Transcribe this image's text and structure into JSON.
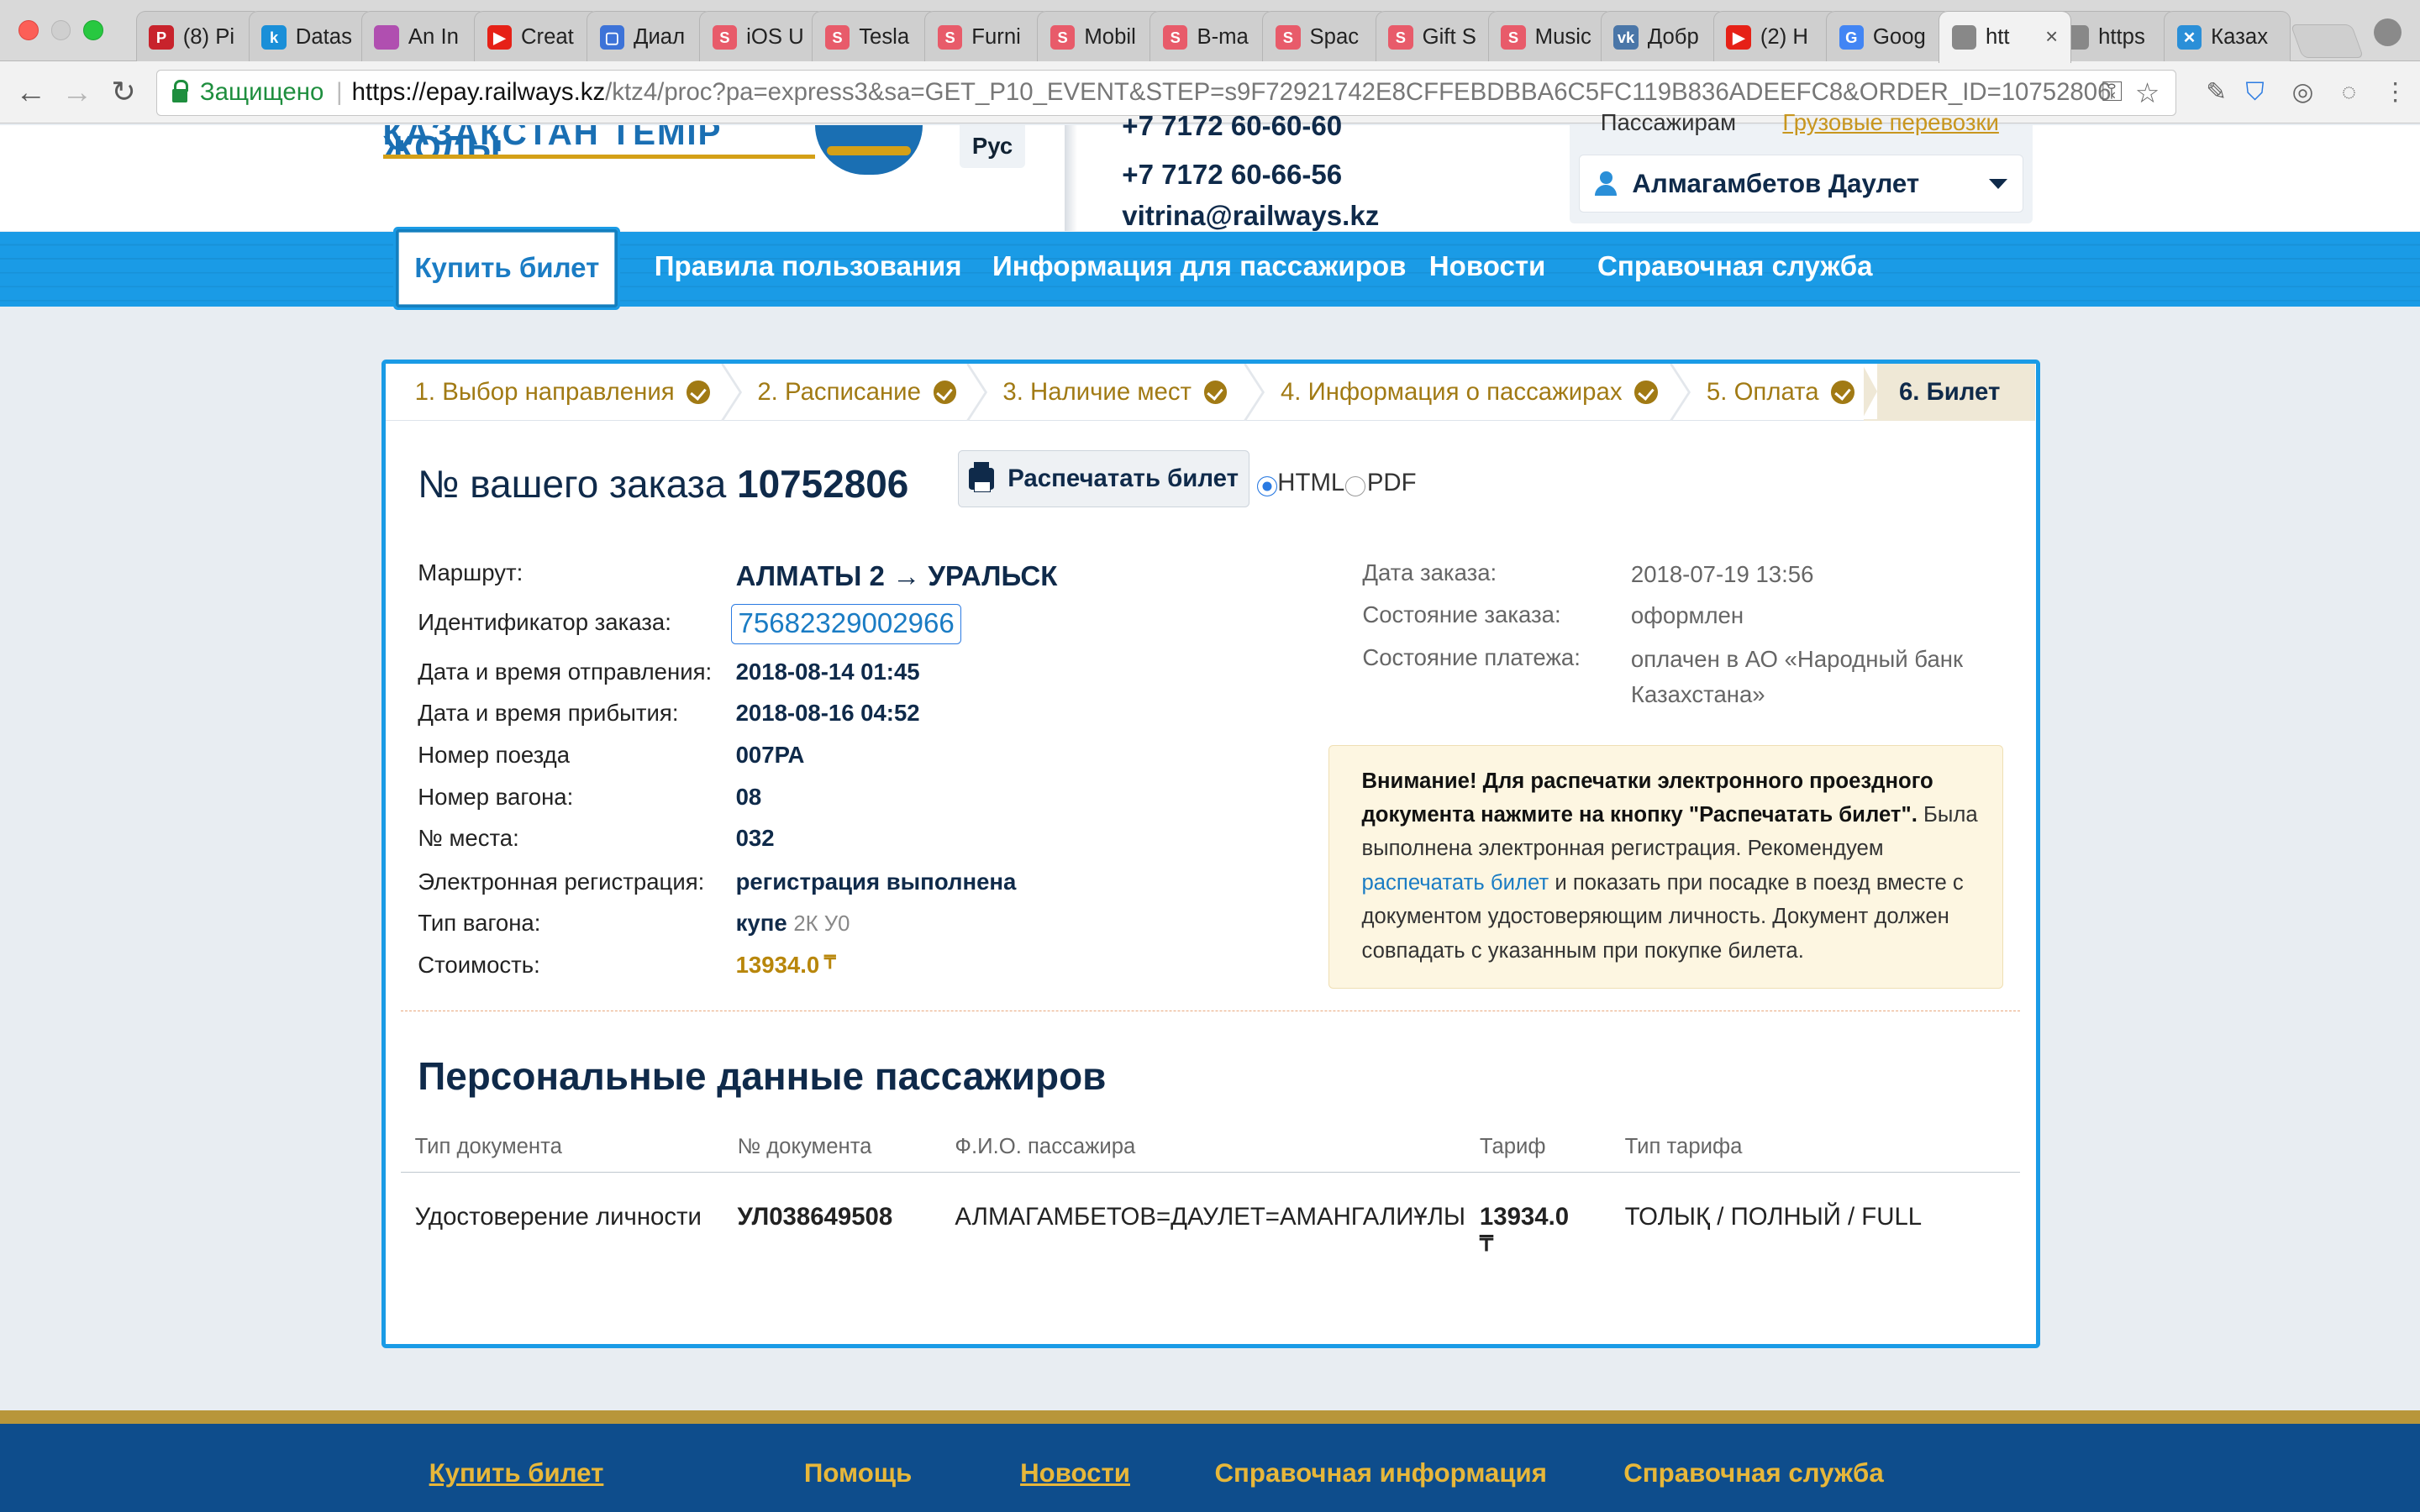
{
  "browser": {
    "tabs": [
      {
        "title": "(8) Pi",
        "icon": "pinterest-icon",
        "color": "#c8232c",
        "glyph": "P"
      },
      {
        "title": "Datas",
        "icon": "k-icon",
        "color": "#1a8fd8",
        "glyph": "k"
      },
      {
        "title": "An In",
        "icon": "gradient-circle-icon",
        "color": "#b04fb0",
        "glyph": ""
      },
      {
        "title": "Creat",
        "icon": "youtube-icon",
        "color": "#e62117",
        "glyph": "▶"
      },
      {
        "title": "Диал",
        "icon": "chat-icon",
        "color": "#3d73d8",
        "glyph": "▢"
      },
      {
        "title": "iOS U",
        "icon": "s-icon",
        "color": "#e85b6a",
        "glyph": "S"
      },
      {
        "title": "Tesla",
        "icon": "s-icon",
        "color": "#e85b6a",
        "glyph": "S"
      },
      {
        "title": "Furni",
        "icon": "s-icon",
        "color": "#e85b6a",
        "glyph": "S"
      },
      {
        "title": "Mobil",
        "icon": "s-icon",
        "color": "#e85b6a",
        "glyph": "S"
      },
      {
        "title": "B-ma",
        "icon": "s-icon",
        "color": "#e85b6a",
        "glyph": "S"
      },
      {
        "title": "Spac",
        "icon": "s-icon",
        "color": "#e85b6a",
        "glyph": "S"
      },
      {
        "title": "Gift S",
        "icon": "s-icon",
        "color": "#e85b6a",
        "glyph": "S"
      },
      {
        "title": "Music",
        "icon": "s-icon",
        "color": "#e85b6a",
        "glyph": "S"
      },
      {
        "title": "Добр",
        "icon": "vk-icon",
        "color": "#4a76a8",
        "glyph": "vk"
      },
      {
        "title": "(2) H",
        "icon": "youtube-icon",
        "color": "#e62117",
        "glyph": "▶"
      },
      {
        "title": "Goog",
        "icon": "google-translate-icon",
        "color": "#4285f4",
        "glyph": "G"
      },
      {
        "title": "htt",
        "icon": "page-icon",
        "color": "#888888",
        "glyph": "",
        "active": true
      },
      {
        "title": "https",
        "icon": "page-icon",
        "color": "#888888",
        "glyph": ""
      },
      {
        "title": "Казах",
        "icon": "globe-icon",
        "color": "#2a8fd8",
        "glyph": "✕"
      }
    ],
    "secure_label": "Защищено",
    "url_host": "https://epay.railways.kz",
    "url_path": "/ktz4/proc?pa=express3&sa=GET_P10_EVENT&STEP=s9F72921742E8CFFEBDBBA6C5FC119B836ADEEFC8&ORDER_ID=10752806"
  },
  "header": {
    "logo_text": "ҚАЗАҚСТАН ТЕМІР ЖОЛЫ",
    "lang": "Рус",
    "phone1": "+7 7172 60-60-60",
    "phone2": "+7 7172 60-66-56",
    "email": "vitrina@railways.kz",
    "tab_passengers": "Пассажирам",
    "tab_cargo": "Грузовые перевозки",
    "user_name": "Алмагамбетов Даулет"
  },
  "nav": {
    "buy": "Купить билет",
    "rules": "Правила пользования",
    "info": "Информация для пассажиров",
    "news": "Новости",
    "help": "Справочная служба"
  },
  "steps": [
    "1. Выбор направления",
    "2. Расписание",
    "3. Наличие мест",
    "4. Информация о пассажирах",
    "5. Оплата"
  ],
  "step_active": "6. Билет",
  "order": {
    "title_prefix": "№ вашего заказа",
    "number": "10752806",
    "print_label": "Распечатать билет",
    "format_html": "HTML",
    "format_pdf": "PDF"
  },
  "details": {
    "route_label": "Маршрут:",
    "route": "АЛМАТЫ 2 → УРАЛЬСК",
    "id_label": "Идентификатор заказа:",
    "id": "75682329002966",
    "dep_label": "Дата и время отправления:",
    "dep": "2018-08-14 01:45",
    "arr_label": "Дата и время прибытия:",
    "arr": "2018-08-16 04:52",
    "train_label": "Номер поезда",
    "train": "007РА",
    "car_label": "Номер вагона:",
    "car": "08",
    "seat_label": "№ места:",
    "seat": "032",
    "ereg_label": "Электронная регистрация:",
    "ereg": "регистрация выполнена",
    "cartype_label": "Тип вагона:",
    "cartype": "купе",
    "cartype_code": "2К У0",
    "cost_label": "Стоимость:",
    "cost": "13934.0",
    "currency": "₸"
  },
  "status": {
    "date_label": "Дата заказа:",
    "date": "2018-07-19 13:56",
    "state_label": "Состояние заказа:",
    "state": "оформлен",
    "pay_label": "Состояние платежа:",
    "pay": "оплачен в АО «Народный банк Казахстана»"
  },
  "notice": {
    "bold": "Внимание! Для распечатки электронного проездного документа нажмите на кнопку \"Распечатать билет\".",
    "text1": " Была выполнена электронная регистрация. Рекомендуем ",
    "link": "распечатать билет",
    "text2": " и показать при посадке в поезд вместе с документом удостоверяющим личность. Документ должен совпадать с указанным при покупке билета."
  },
  "passengers": {
    "heading": "Персональные данные пассажиров",
    "columns": [
      "Тип документа",
      "№ документа",
      "Ф.И.О. пассажира",
      "Тариф",
      "Тип тарифа"
    ],
    "rows": [
      [
        "Удостоверение личности",
        "УЛ038649508",
        "АЛМАГАМБЕТОВ=ДАУЛЕТ=АМАНГАЛИҰЛЫ",
        "13934.0",
        "ТОЛЫҚ / ПОЛНЫЙ / FULL"
      ]
    ],
    "currency": "₸"
  },
  "footer": [
    "Купить билет",
    "Помощь",
    "Новости",
    "Справочная информация",
    "Справочная служба"
  ]
}
